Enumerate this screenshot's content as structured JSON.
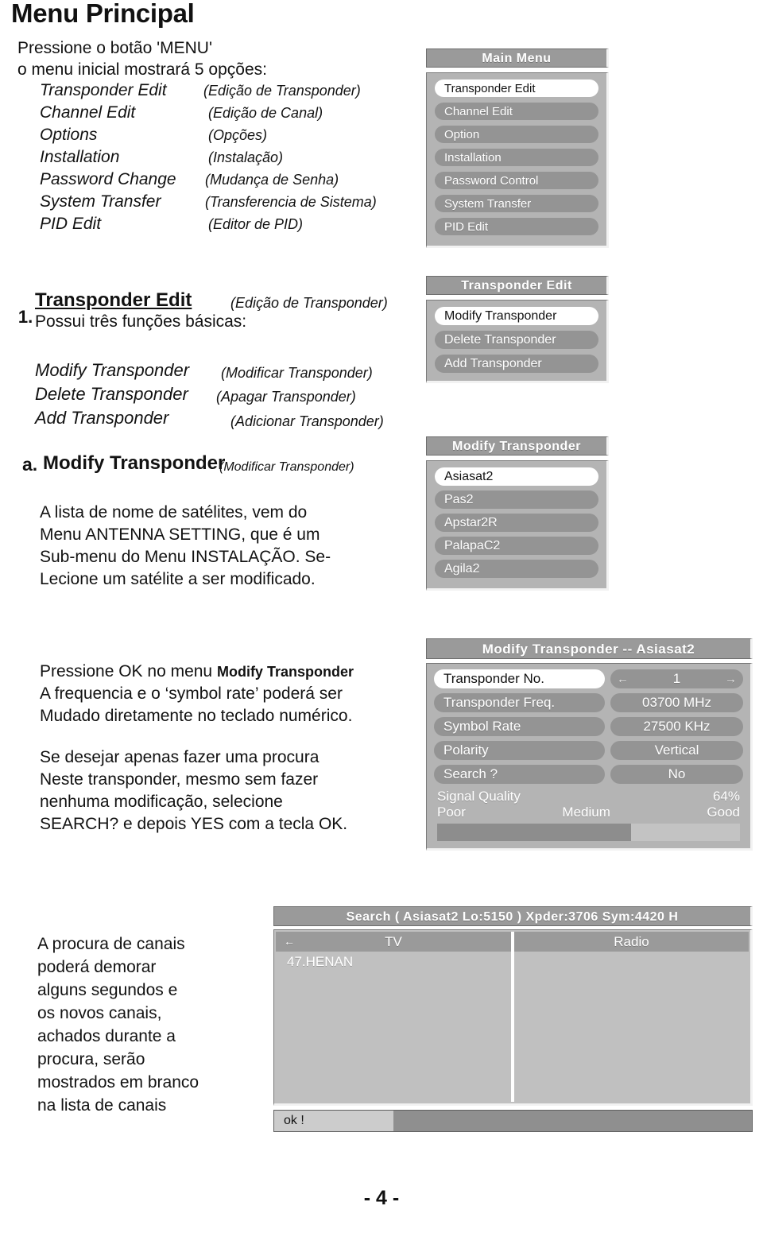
{
  "page": {
    "title": "Menu Principal",
    "number": "- 4 -"
  },
  "intro": {
    "line1": "Pressione o botão 'MENU'",
    "line2": "o menu inicial mostrará 5 opções:",
    "options": [
      {
        "en": "Transponder Edit",
        "pt": "(Edição de Transponder)"
      },
      {
        "en": "Channel Edit",
        "pt": "(Edição de Canal)"
      },
      {
        "en": "Options",
        "pt": "(Opções)"
      },
      {
        "en": "Installation",
        "pt": "(Instalação)"
      },
      {
        "en": "Password Change",
        "pt": "(Mudança de Senha)"
      },
      {
        "en": "System Transfer",
        "pt": "(Transferencia de Sistema)"
      },
      {
        "en": "PID Edit",
        "pt": "(Editor de PID)"
      }
    ]
  },
  "section1": {
    "number": "1.",
    "heading": "Transponder Edit",
    "heading_pt": "(Edição de Transponder)",
    "subtitle": "Possui três funções básicas:",
    "functions": [
      {
        "en": "Modify Transponder",
        "pt": "(Modificar Transponder)"
      },
      {
        "en": "Delete Transponder",
        "pt": "(Apagar Transponder)"
      },
      {
        "en": "Add Transponder",
        "pt": "(Adicionar Transponder)"
      }
    ]
  },
  "section_a": {
    "number": "a.",
    "heading": "Modify Transponder",
    "heading_pt": "(Modificar Transponder)",
    "body": [
      "A lista de nome de satélites, vem do",
      "Menu ANTENNA SETTING, que é um",
      "Sub-menu do Menu INSTALAÇÃO. Se-",
      "Lecione um satélite a ser modificado."
    ]
  },
  "section_b": {
    "para1_a": "Pressione OK no menu ",
    "para1_bold": "Modify Transponder",
    "para1_rest": [
      "A frequencia e o ‘symbol rate’ poderá ser",
      "Mudado diretamente no teclado numérico."
    ],
    "para2": [
      "Se desejar apenas fazer uma procura",
      "Neste transponder, mesmo sem fazer",
      "nenhuma modificação, selecione",
      "SEARCH? e depois YES com a tecla OK."
    ]
  },
  "section_c": {
    "body": [
      "A procura de canais",
      "poderá demorar",
      "alguns segundos e",
      "os novos canais,",
      "achados durante a",
      "procura, serão",
      "mostrados em branco",
      "na lista de canais"
    ]
  },
  "main_menu": {
    "title": "Main Menu",
    "items": [
      {
        "label": "Transponder Edit",
        "selected": true
      },
      {
        "label": "Channel Edit",
        "selected": false
      },
      {
        "label": "Option",
        "selected": false
      },
      {
        "label": "Installation",
        "selected": false
      },
      {
        "label": "Password Control",
        "selected": false
      },
      {
        "label": "System Transfer",
        "selected": false
      },
      {
        "label": "PID Edit",
        "selected": false
      }
    ]
  },
  "transponder_edit_menu": {
    "title": "Transponder Edit",
    "items": [
      {
        "label": "Modify Transponder",
        "selected": true
      },
      {
        "label": "Delete Transponder",
        "selected": false
      },
      {
        "label": "Add Transponder",
        "selected": false
      }
    ]
  },
  "modify_transponder_menu": {
    "title": "Modify Transponder",
    "items": [
      {
        "label": "Asiasat2",
        "selected": true
      },
      {
        "label": "Pas2",
        "selected": false
      },
      {
        "label": "Apstar2R",
        "selected": false
      },
      {
        "label": "PalapaC2",
        "selected": false
      },
      {
        "label": "Agila2",
        "selected": false
      }
    ]
  },
  "detail_panel": {
    "title": "Modify Transponder -- Asiasat2",
    "rows": [
      {
        "label": "Transponder No.",
        "value": "1",
        "selected": true,
        "arrows": true
      },
      {
        "label": "Transponder Freq.",
        "value": "03700 MHz",
        "selected": false,
        "arrows": false
      },
      {
        "label": "Symbol Rate",
        "value": "27500 KHz",
        "selected": false,
        "arrows": false
      },
      {
        "label": "Polarity",
        "value": "Vertical",
        "selected": false,
        "arrows": false
      },
      {
        "label": "Search ?",
        "value": "No",
        "selected": false,
        "arrows": false
      }
    ],
    "signal_quality_label": "Signal Quality",
    "signal_quality_percent": "64%",
    "scale_poor": "Poor",
    "scale_medium": "Medium",
    "scale_good": "Good",
    "signal_value": 64,
    "arrow_left": "←",
    "arrow_right": "→"
  },
  "search_panel": {
    "title": "Search ( Asiasat2 Lo:5150 )  Xpder:3706  Sym:4420  H",
    "tv_header": "TV",
    "radio_header": "Radio",
    "back_arrow": "←",
    "tv_items": [
      "47.HENAN"
    ],
    "radio_items": [],
    "progress_label": "ok !",
    "progress_percent": 25
  },
  "colors": {
    "panel_title_bg": "#9a9a9a",
    "panel_body_bg": "#b4b4b4",
    "pill_bg": "#949494",
    "pill_selected_bg": "#ffffff",
    "bar_fill": "#8d8d8d",
    "bar_track": "#c3c3c3"
  }
}
